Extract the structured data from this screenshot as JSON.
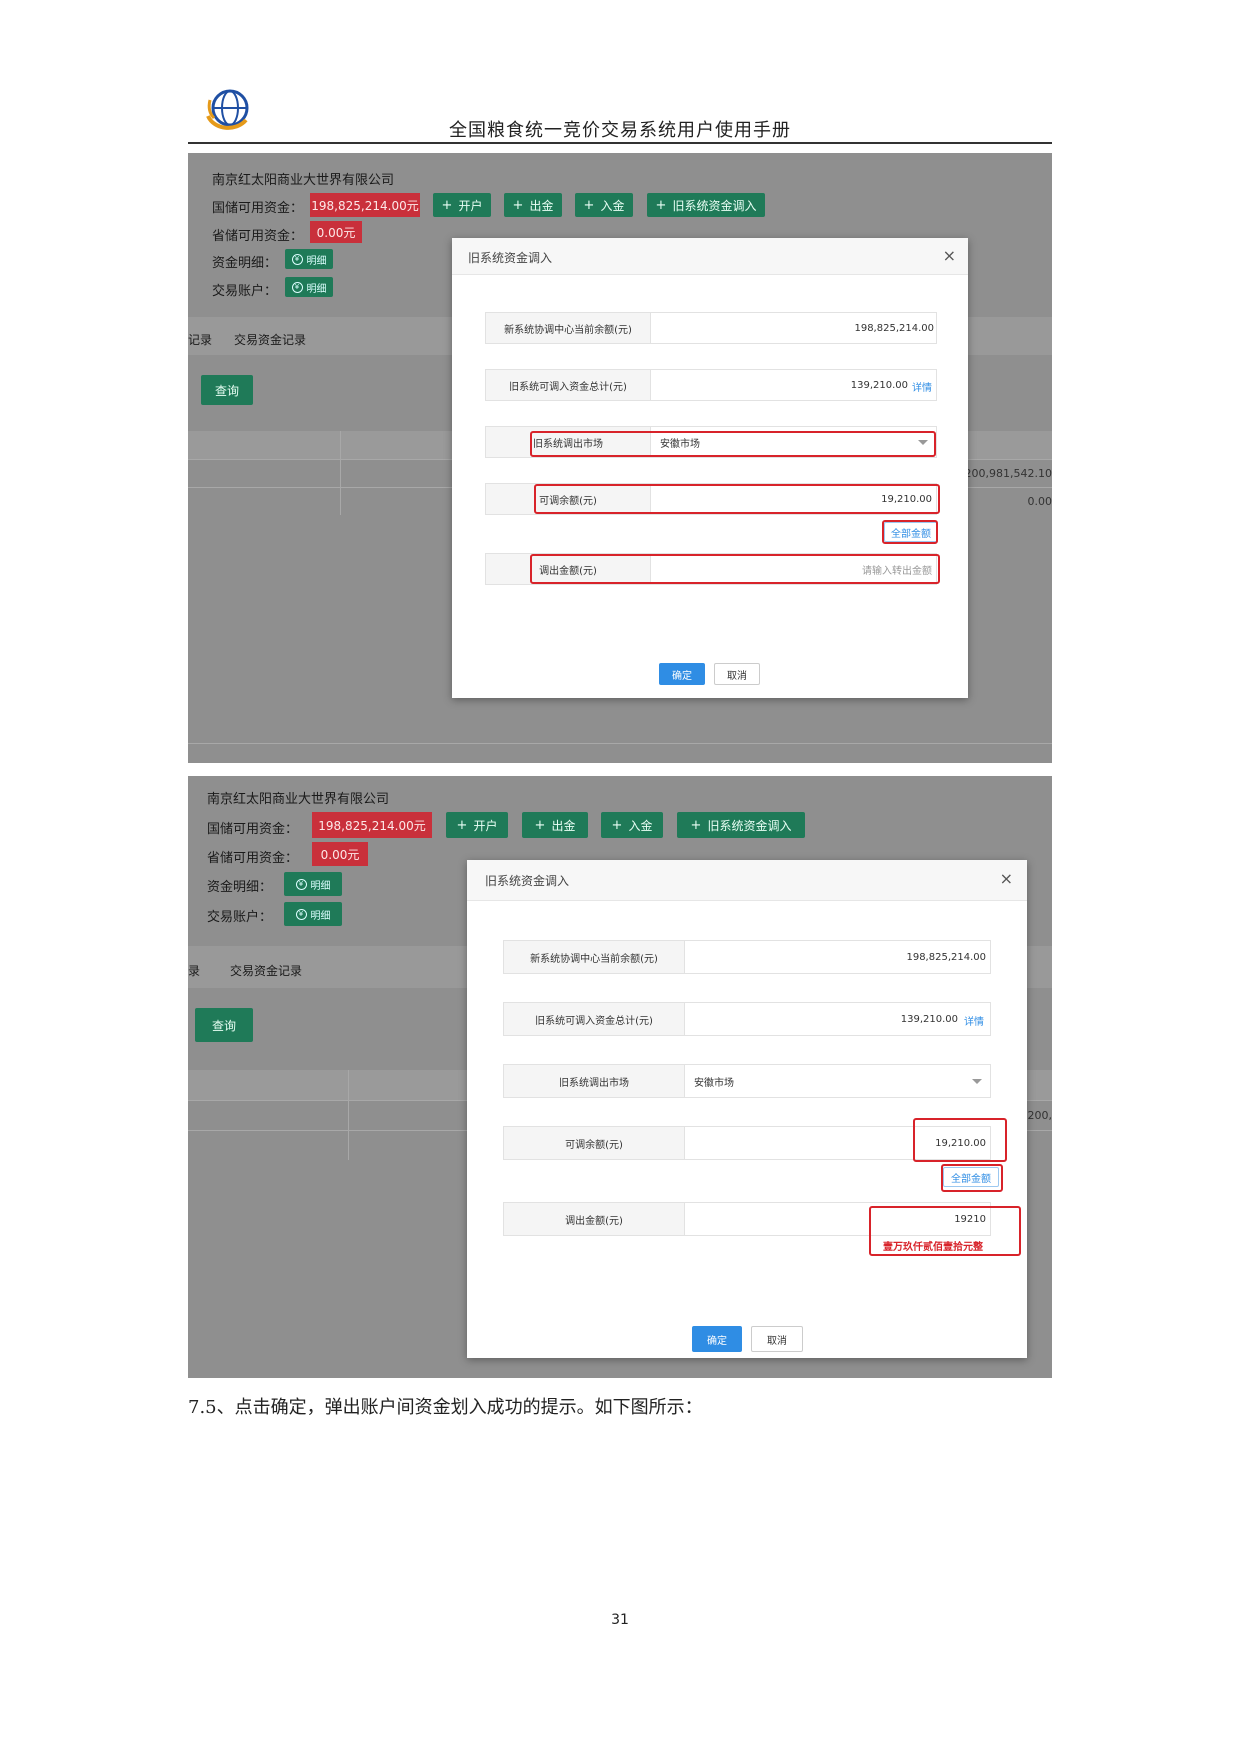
{
  "header": {
    "title": "全国粮食统一竞价交易系统用户使用手册"
  },
  "panel": {
    "company": "南京红太阳商业大世界有限公司",
    "guochu_label": "国储可用资金：",
    "guochu_value": "198,825,214.00元",
    "shengchu_label": "省储可用资金：",
    "shengchu_value": "0.00元",
    "zijin_label": "资金明细：",
    "jiaoyi_label": "交易账户：",
    "detail_btn": "明细",
    "btn_open": "开户",
    "btn_out": "出金",
    "btn_in": "入金",
    "btn_old": "旧系统资金调入",
    "tab_prefix1": "记录",
    "tab_prefix2": "录",
    "tab_trade": "交易资金记录",
    "query_btn": "查询",
    "cell_val1": "200,981,542.10",
    "cell_val2": "0.00",
    "cell_val3": "200,"
  },
  "modal": {
    "title": "旧系统资金调入",
    "close": "×",
    "row1_label": "新系统协调中心当前余额(元)",
    "row1_value": "198,825,214.00",
    "row2_label": "旧系统可调入资金总计(元)",
    "row2_value": "139,210.00",
    "row2_link": "详情",
    "row3_label": "旧系统调出市场",
    "row3_value": "安徽市场",
    "row4_label": "可调余额(元)",
    "row4_value": "19,210.00",
    "all_btn": "全部金额",
    "row5_label": "调出金额(元)",
    "row5_placeholder": "请输入转出金额",
    "row5_value2": "19210",
    "row5_capital": "壹万玖仟贰佰壹拾元整",
    "ok_btn": "确定",
    "cancel_btn": "取消"
  },
  "caption": "7.5、点击确定，弹出账户间资金划入成功的提示。如下图所示：",
  "page_number": "31"
}
